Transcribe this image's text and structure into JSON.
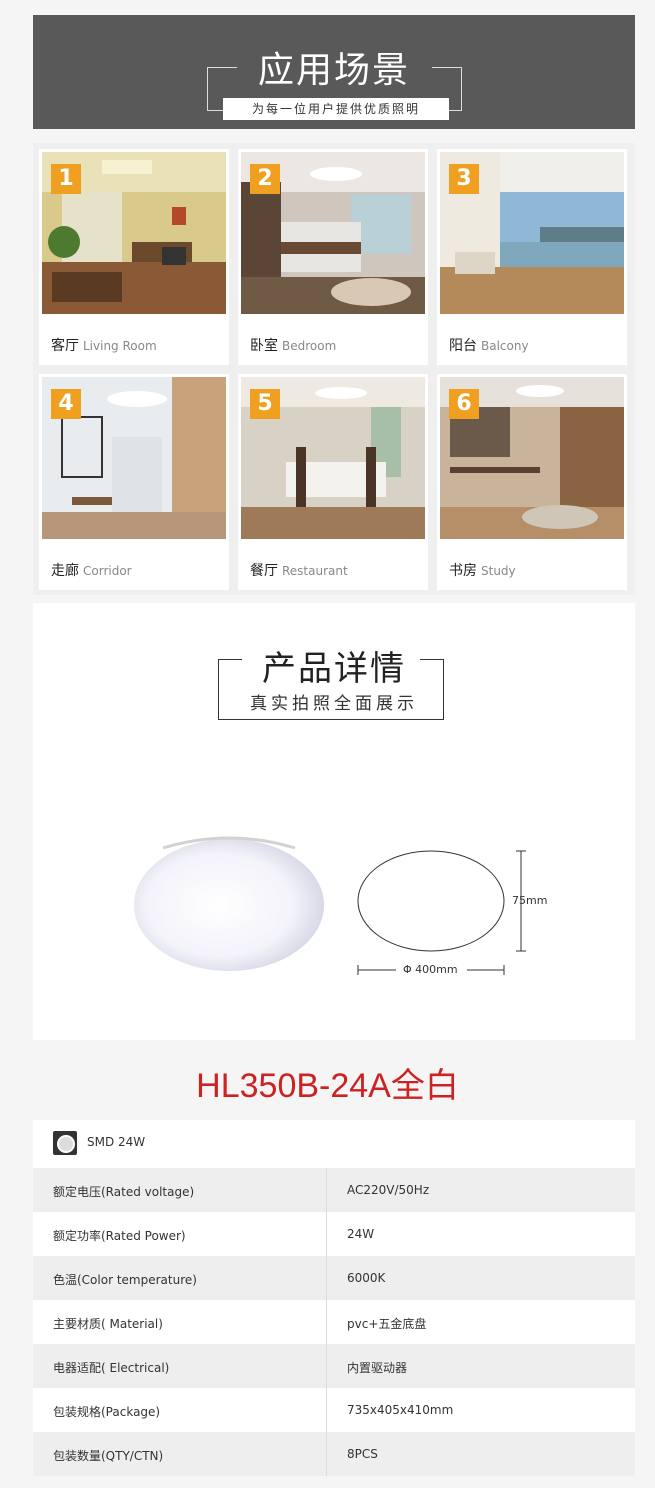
{
  "banner": {
    "title": "应用场景",
    "subtitle": "为每一位用户提供优质照明"
  },
  "scenes": [
    {
      "num": "1",
      "cn": "客厅",
      "en": "Living Room"
    },
    {
      "num": "2",
      "cn": "卧室",
      "en": "Bedroom"
    },
    {
      "num": "3",
      "cn": "阳台",
      "en": "Balcony"
    },
    {
      "num": "4",
      "cn": "走廊",
      "en": "Corridor"
    },
    {
      "num": "5",
      "cn": "餐厅",
      "en": "Restaurant"
    },
    {
      "num": "6",
      "cn": "书房",
      "en": "Study"
    }
  ],
  "detail": {
    "title": "产品详情",
    "subtitle": "真实拍照全面展示",
    "height_label": "75mm",
    "diameter_label": "Φ 400mm"
  },
  "model": "HL350B-24A全白",
  "spec": {
    "header": "SMD 24W",
    "rows": [
      {
        "k": "额定电压(Rated voltage)",
        "v": "AC220V/50Hz"
      },
      {
        "k": "额定功率(Rated Power)",
        "v": "24W"
      },
      {
        "k": "色温(Color temperature)",
        "v": "6000K"
      },
      {
        "k": "主要材质( Material)",
        "v": "pvc+五金底盘"
      },
      {
        "k": "电器适配( Electrical)",
        "v": "内置驱动器"
      },
      {
        "k": "包装规格(Package)",
        "v": "735x405x410mm"
      },
      {
        "k": "包装数量(QTY/CTN)",
        "v": "8PCS"
      }
    ]
  },
  "colors": {
    "accent": "#f0a020",
    "model": "#cc2222",
    "banner": "#595959"
  }
}
